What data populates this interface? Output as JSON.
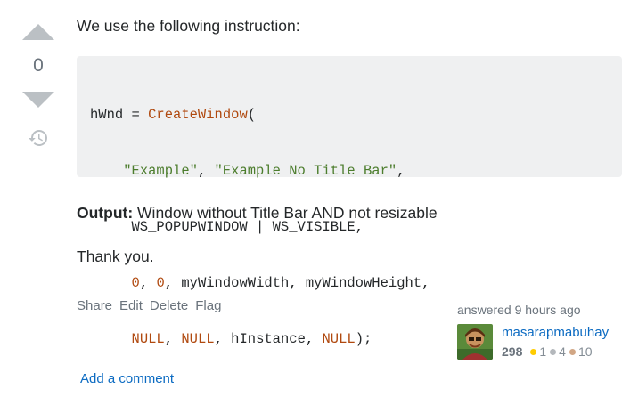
{
  "vote": {
    "count": "0",
    "upvote_icon": "triangle-up-icon",
    "downvote_icon": "triangle-down-icon",
    "history_icon": "history-icon"
  },
  "post": {
    "intro": "We use the following instruction:",
    "code_lines": [
      "hWnd = CreateWindow(",
      "    \"Example\", \"Example No Title Bar\",",
      "     WS_POPUPWINDOW | WS_VISIBLE,",
      "     0, 0, myWindowWidth, myWindowHeight,",
      "     NULL, NULL, hInstance, NULL);"
    ],
    "output_label": "Output:",
    "output_text": " Window without Title Bar AND not resizable",
    "thanks": "Thank you."
  },
  "menu": {
    "share": "Share",
    "edit": "Edit",
    "delete": "Delete",
    "flag": "Flag"
  },
  "user_card": {
    "answered": "answered 9 hours ago",
    "user_name": "masarapmabuhay",
    "reputation": "298",
    "gold": "1",
    "silver": "4",
    "bronze": "10",
    "colors": {
      "gold": "#ffcc01",
      "silver": "#b4b8bc",
      "bronze": "#d1a684"
    }
  },
  "comments": {
    "add_comment": "Add a comment"
  },
  "colors": {
    "link": "#0c6bc2",
    "muted": "#6a737c",
    "code_bg": "#eff0f1",
    "arrow": "#bbc0c4"
  }
}
